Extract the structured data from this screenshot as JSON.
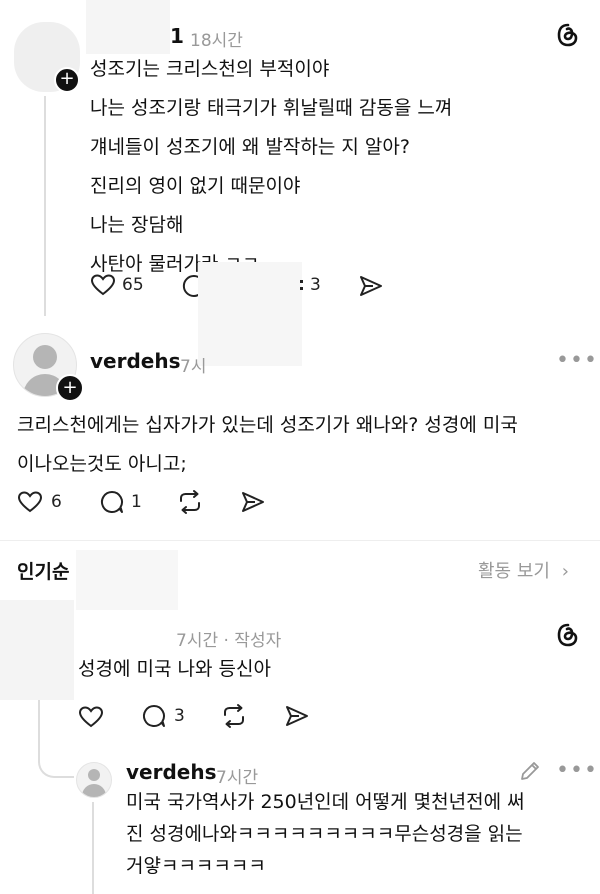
{
  "post1": {
    "name_fragment": "1",
    "time": "18시간",
    "lines": [
      "성조기는 크리스천의 부적이야",
      "나는 성조기랑 태극기가 휘날릴때 감동을 느껴",
      "걔네들이 성조기에 왜 발작하는 지 알아?",
      "진리의 영이 없기 때문이야",
      "나는 장담해",
      "사탄아 물러가라 ㅋㅋ"
    ],
    "likes": "65",
    "reposts": "3"
  },
  "post2": {
    "name": "verdehs",
    "time": "7시",
    "lines": [
      "크리스천에게는 십자가가 있는데 성조기가 왜나와? 성경에 미국",
      "이나오는것도 아니고;"
    ],
    "likes": "6",
    "comments": "1"
  },
  "section": {
    "title": "인기순",
    "activity": "활동 보기"
  },
  "reply1": {
    "meta": "7시간 · 작성자",
    "text": "성경에 미국 나와 등신아",
    "comments": "3"
  },
  "reply2": {
    "name": "verdehs",
    "time": "7시간",
    "lines": [
      "미국 국가역사가 250년인데 어떻게 몇천년전에 써",
      "진 성경에나와ㅋㅋㅋㅋㅋㅋㅋㅋㅋ무슨성경을 읽는",
      "거얗ㅋㅋㅋㅋㅋㅋ"
    ]
  }
}
